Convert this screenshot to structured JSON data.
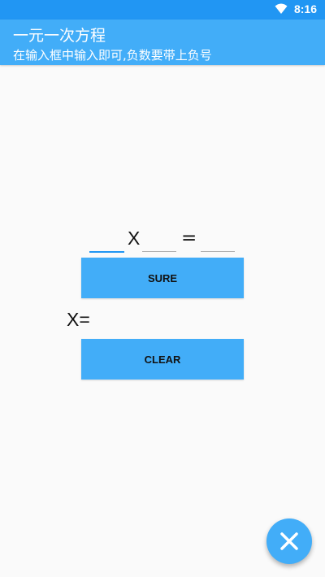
{
  "status_bar": {
    "time": "8:16",
    "icons": [
      "wifi-icon"
    ]
  },
  "app_bar": {
    "title": "一元一次方程",
    "subtitle": "在输入框中输入即可,负数要带上负号"
  },
  "equation": {
    "coefficient_value": "",
    "constant_value": "",
    "right_value": "",
    "variable_label": "X",
    "equals_label": "="
  },
  "buttons": {
    "sure_label": "SURE",
    "clear_label": "CLEAR"
  },
  "result": {
    "label": "X=",
    "value": ""
  },
  "fab": {
    "icon": "close-icon"
  },
  "colors": {
    "status_bar": "#2196f3",
    "app_bar": "#42adf8",
    "button": "#42adf8",
    "background": "#fafafa",
    "input_focus_line": "#2196f3"
  }
}
